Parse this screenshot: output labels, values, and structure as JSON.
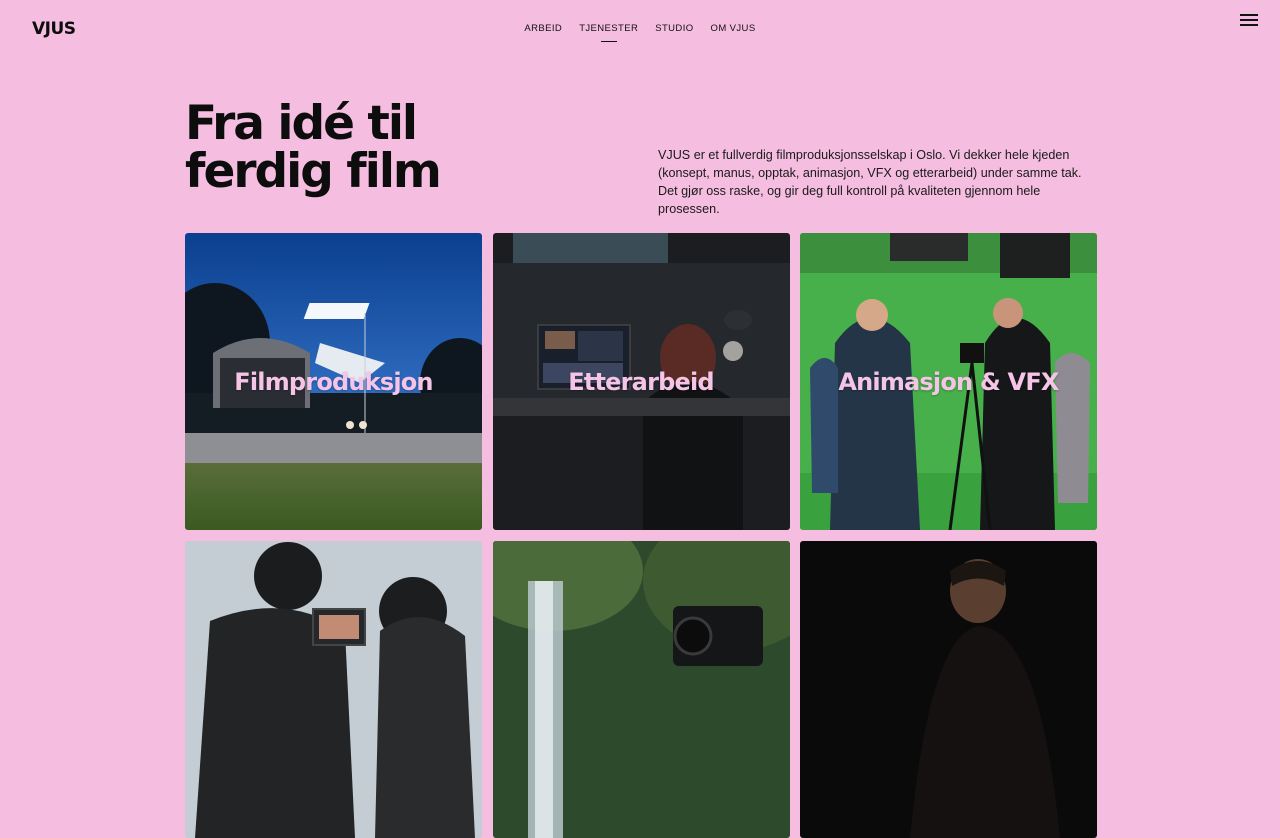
{
  "header": {
    "logo": "VJUS",
    "nav": [
      {
        "label": "ARBEID"
      },
      {
        "label": "TJENESTER"
      },
      {
        "label": "STUDIO"
      },
      {
        "label": "OM VJUS"
      }
    ],
    "active_nav": "TJENESTER",
    "menu_icon": "hamburger-menu-icon"
  },
  "hero": {
    "title_line1": "Fra idé til",
    "title_line2": "ferdig film",
    "description": "VJUS er et fullverdig filmproduksjonsselskap i Oslo. Vi dekker hele kjeden (konsept, manus, opptak, animasjon, VFX og etterarbeid) under samme tak. Det gjør oss raske, og gir deg full kontroll på kvaliteten gjennom hele prosessen."
  },
  "services": [
    {
      "label": "Filmproduksjon"
    },
    {
      "label": "Etterarbeid"
    },
    {
      "label": "Animasjon & VFX"
    },
    {
      "label": ""
    },
    {
      "label": ""
    },
    {
      "label": ""
    }
  ],
  "colors": {
    "background": "#f5bde0",
    "card_label": "#f6c4e6",
    "text": "#111111"
  }
}
